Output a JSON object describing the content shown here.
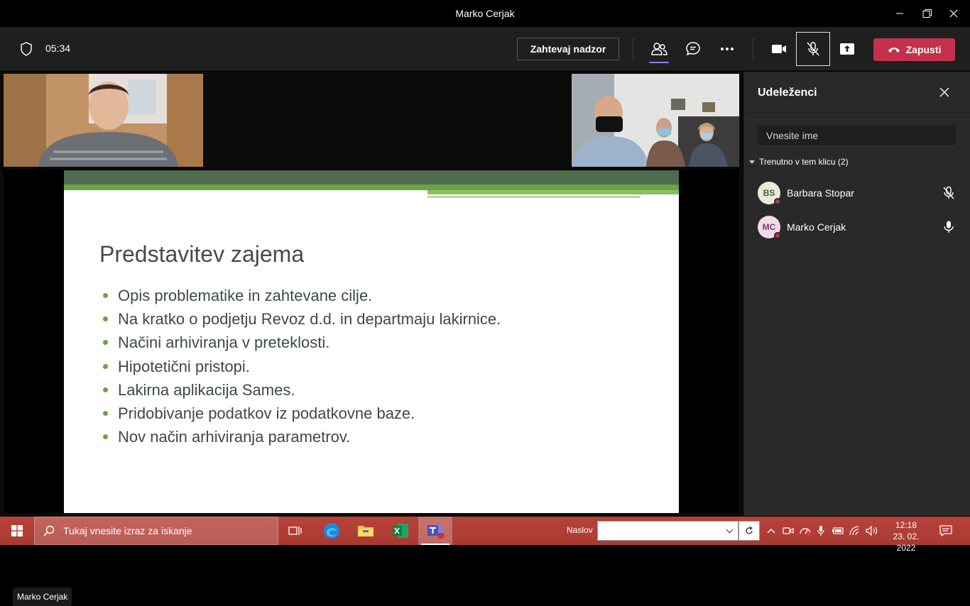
{
  "window": {
    "title": "Marko Cerjak"
  },
  "toolbar": {
    "timer": "05:34",
    "request_control_label": "Zahtevaj nadzor",
    "leave_label": "Zapusti"
  },
  "slide": {
    "title": "Predstavitev zajema",
    "bullets": [
      "Opis problematike in zahtevane cilje.",
      "Na kratko o podjetju Revoz d.d. in departmaju lakirnice.",
      "Načini arhiviranja v preteklosti.",
      "Hipotetični pristopi.",
      "Lakirna aplikacija Sames.",
      "Pridobivanje podatkov iz podatkovne baze.",
      "Nov način arhiviranja parametrov."
    ]
  },
  "presenter_label": "Marko Cerjak",
  "panel": {
    "title": "Udeleženci",
    "search_placeholder": "Vnesite ime",
    "group_label": "Trenutno v tem klicu (2)",
    "participants": [
      {
        "initials": "BS",
        "name": "Barbara Stopar",
        "avatar_bg": "#e8ebd9",
        "avatar_fg": "#4f5a3a",
        "mic": "muted"
      },
      {
        "initials": "MC",
        "name": "Marko Cerjak",
        "avatar_bg": "#f1dbe8",
        "avatar_fg": "#7a4164",
        "mic": "on"
      }
    ]
  },
  "taskbar": {
    "search_placeholder": "Tukaj vnesite izraz za iskanje",
    "address_label": "Naslov",
    "time": "12:18",
    "date": "23. 02. 2022"
  },
  "colors": {
    "leave": "#c4314b",
    "accent": "#7f85f5",
    "slide_green": "#6aa343"
  }
}
